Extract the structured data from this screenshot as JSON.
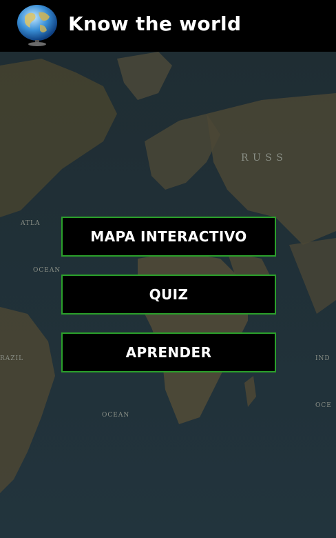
{
  "app": {
    "title": "Know the world"
  },
  "menu": {
    "buttons": [
      {
        "label": "MAPA INTERACTIVO"
      },
      {
        "label": "QUIZ"
      },
      {
        "label": "APRENDER"
      }
    ]
  },
  "map_labels": {
    "russia": "R U S S",
    "ocean_left": "OCEAN",
    "ocean_bottom": "OCEAN",
    "ocean_right": "OCE",
    "brazil": "RAZIL",
    "indian": "IND",
    "atlantic": "ATLA"
  },
  "colors": {
    "appbar": "#000000",
    "button_border": "#2aa02a",
    "ocean": "#1b2a33",
    "land": "#4a4636"
  }
}
